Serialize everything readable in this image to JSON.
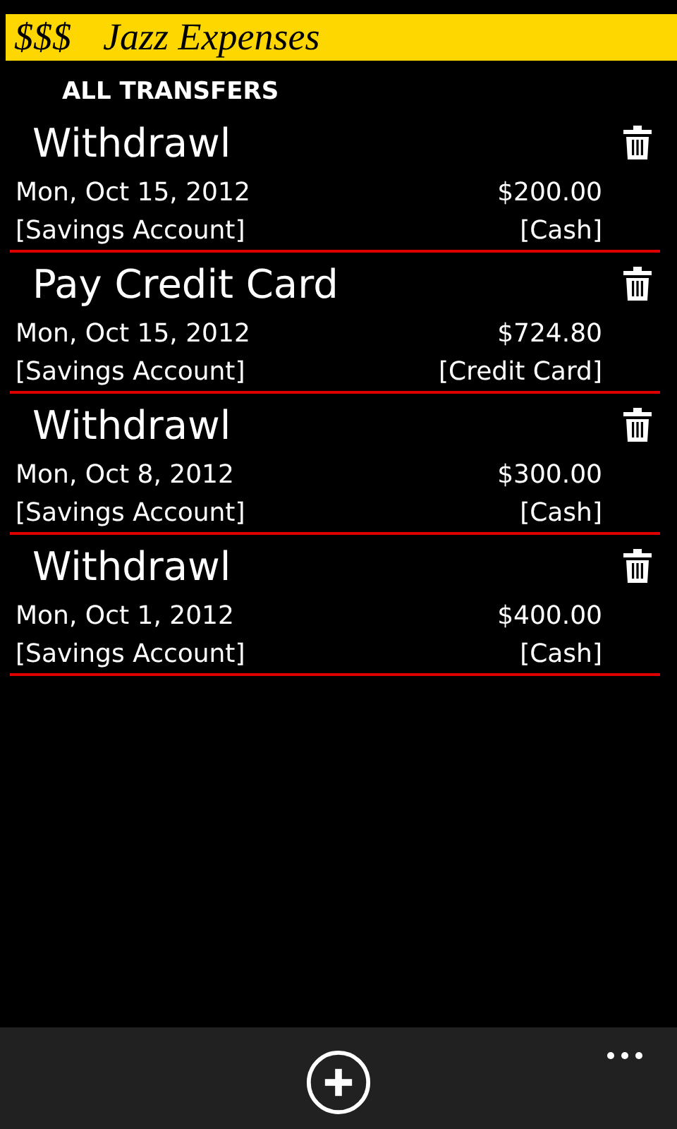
{
  "header": {
    "symbol": "$$$",
    "title": "Jazz Expenses"
  },
  "page_title": "ALL TRANSFERS",
  "transfers": [
    {
      "name": "Withdrawl",
      "date": "Mon, Oct 15, 2012",
      "amount": "$200.00",
      "from": "[Savings Account]",
      "to": "[Cash]"
    },
    {
      "name": "Pay Credit Card",
      "date": "Mon, Oct 15, 2012",
      "amount": "$724.80",
      "from": "[Savings Account]",
      "to": "[Credit Card]"
    },
    {
      "name": "Withdrawl",
      "date": "Mon, Oct 8, 2012",
      "amount": "$300.00",
      "from": "[Savings Account]",
      "to": "[Cash]"
    },
    {
      "name": "Withdrawl",
      "date": "Mon, Oct 1, 2012",
      "amount": "$400.00",
      "from": "[Savings Account]",
      "to": "[Cash]"
    }
  ]
}
